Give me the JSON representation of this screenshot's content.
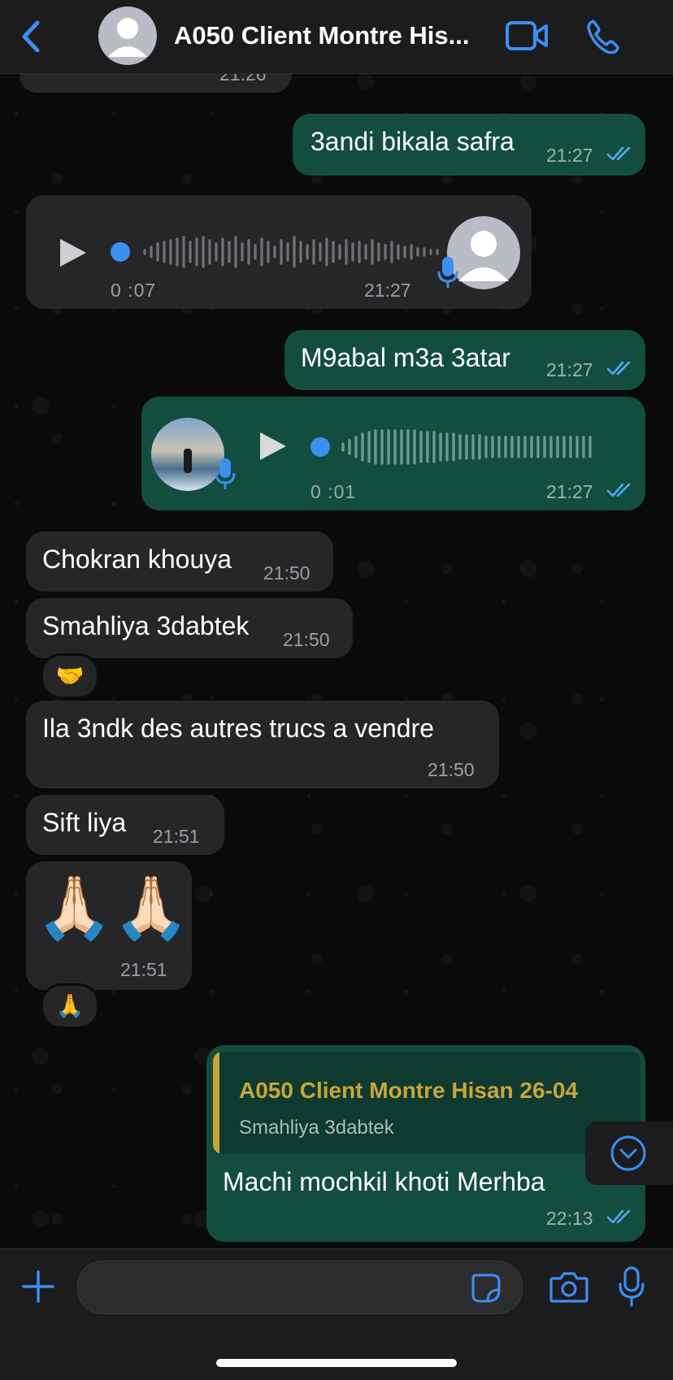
{
  "header": {
    "title": "A050 Client Montre His...",
    "back_icon": "chevron-left-icon",
    "video_icon": "video-camera-icon",
    "call_icon": "phone-icon"
  },
  "colors": {
    "accent": "#3c8ff1",
    "incoming_bubble": "#262628",
    "outgoing_bubble": "#134d3f",
    "quote_accent": "#c9a53a"
  },
  "messages": {
    "m0": {
      "time": "21:26"
    },
    "m1": {
      "text": "3andi bikala safra",
      "time": "21:27",
      "status": "read"
    },
    "m2": {
      "type": "voice",
      "duration": "0 :07",
      "time": "21:27"
    },
    "m3": {
      "text": "M9abal m3a 3atar",
      "time": "21:27",
      "status": "read"
    },
    "m4": {
      "type": "voice",
      "duration": "0 :01",
      "time": "21:27",
      "status": "read"
    },
    "m5": {
      "text": "Chokran khouya",
      "time": "21:50"
    },
    "m6": {
      "text": "Smahliya 3dabtek",
      "time": "21:50",
      "reaction": "🤝"
    },
    "m7": {
      "text": "Ila 3ndk des autres trucs a vendre",
      "time": "21:50"
    },
    "m8": {
      "text": "Sift liya",
      "time": "21:51"
    },
    "m9": {
      "text": "🙏🏻🙏🏻",
      "time": "21:51",
      "reaction": "🙏"
    },
    "m10": {
      "quote_title": "A050 Client Montre Hisan 26-04",
      "quote_text": "Smahliya 3dabtek",
      "text": "Machi mochkil khoti Merhba",
      "time": "22:13",
      "status": "read"
    }
  },
  "input": {
    "placeholder": "",
    "plus_icon": "plus-icon",
    "sticker_icon": "sticker-icon",
    "camera_icon": "camera-icon",
    "mic_icon": "microphone-icon"
  }
}
